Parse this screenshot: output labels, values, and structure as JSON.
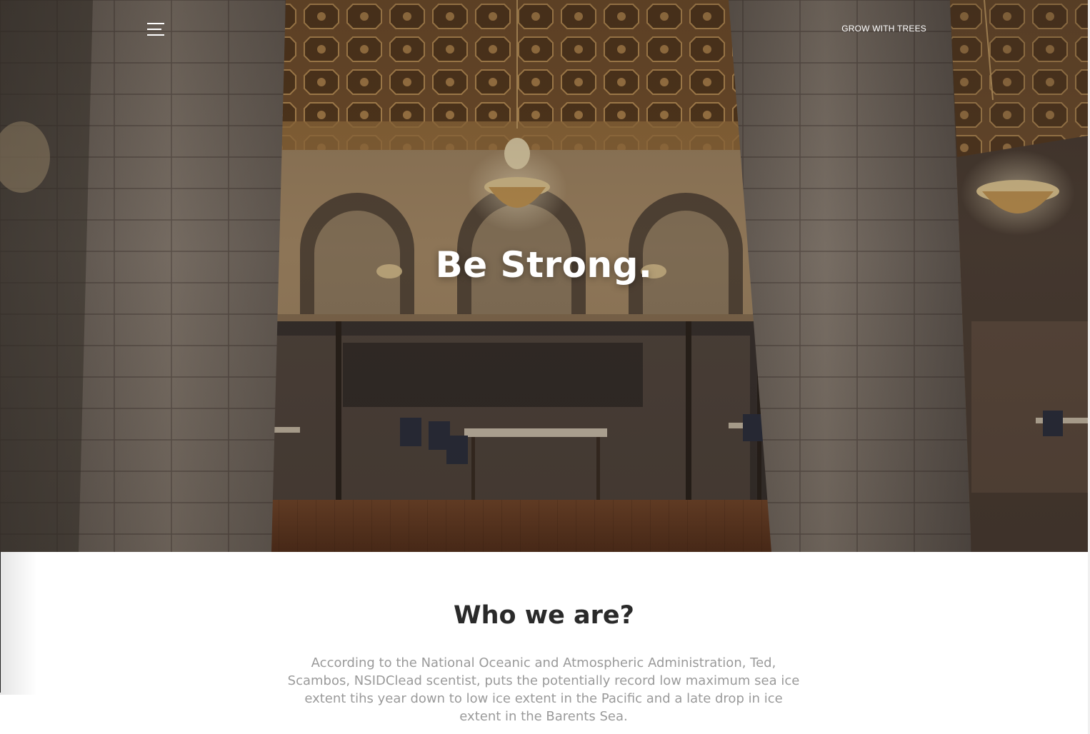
{
  "header": {
    "menu_icon": "hamburger-menu-icon",
    "brand_link": "GROW WITH TREES"
  },
  "hero": {
    "title": "Be Strong.",
    "background": "interior-hall-photo"
  },
  "about": {
    "title": "Who we are?",
    "text": "According to the National Oceanic and Atmospheric Administration, Ted, Scambos, NSIDClead scentist, puts the potentially record low maximum sea ice extent tihs year down to low ice extent in the Pacific and a late drop in ice extent in the Barents Sea."
  },
  "colors": {
    "hero_text": "#ffffff",
    "about_title": "#2a2a2a",
    "about_text": "#9a9a9a"
  }
}
